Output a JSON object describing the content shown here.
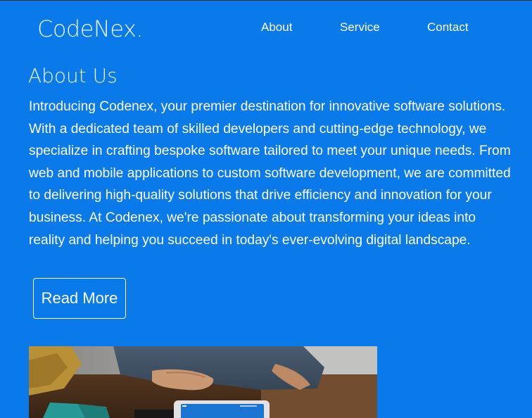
{
  "brand": {
    "logo_text": "CodeNex."
  },
  "nav": {
    "items": [
      {
        "label": "About"
      },
      {
        "label": "Service"
      },
      {
        "label": "Contact"
      }
    ]
  },
  "about": {
    "title": "About Us",
    "body": "Introducing Codenex, your premier destination for innovative software solutions. With a dedicated team of skilled developers and cutting-edge technology, we specialize in crafting bespoke software tailored to meet your unique needs. From web and mobile applications to custom software development, we are committed to delivering high-quality solutions that drive efficiency and innovation for your business. At Codenex, we're passionate about transforming your ideas into reality and helping you succeed in today's ever-evolving digital landscape.",
    "button_label": "Read More"
  },
  "colors": {
    "background": "#0a7aea",
    "text": "#ffffff"
  }
}
